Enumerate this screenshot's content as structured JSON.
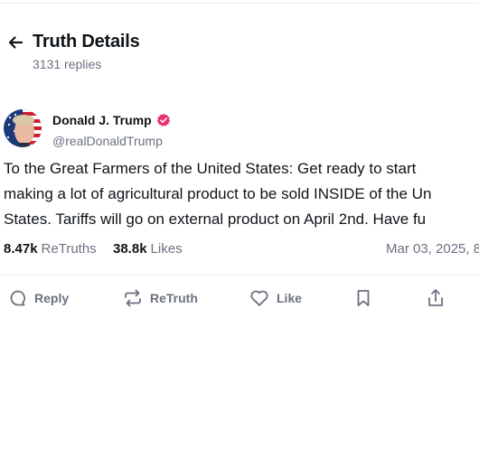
{
  "header": {
    "title": "Truth Details",
    "reply_count": "3131 replies"
  },
  "post": {
    "author": {
      "name": "Donald J. Trump",
      "handle": "@realDonaldTrump",
      "verified": true
    },
    "text_lines": [
      "To the Great Farmers of the United States: Get ready to start",
      "making a lot of agricultural product to be sold INSIDE of the Un",
      "States. Tariffs will go on external product on April 2nd. Have fu"
    ],
    "stats": {
      "retruths_count": "8.47k",
      "retruths_label": "ReTruths",
      "likes_count": "38.8k",
      "likes_label": "Likes"
    },
    "date": "Mar 03, 2025, 8"
  },
  "actions": {
    "reply_label": "Reply",
    "retruth_label": "ReTruth",
    "like_label": "Like"
  },
  "icons": {
    "back": "arrow-left-icon",
    "verified": "verified-badge-icon",
    "reply": "chat-bubble-icon",
    "retruth": "repost-arrows-icon",
    "like": "heart-icon",
    "bookmark": "bookmark-icon",
    "share": "share-icon"
  },
  "colors": {
    "text_primary": "#0f1419",
    "text_secondary": "#6b7180",
    "verified_badge": "#e8336a",
    "divider": "#ececf0"
  }
}
